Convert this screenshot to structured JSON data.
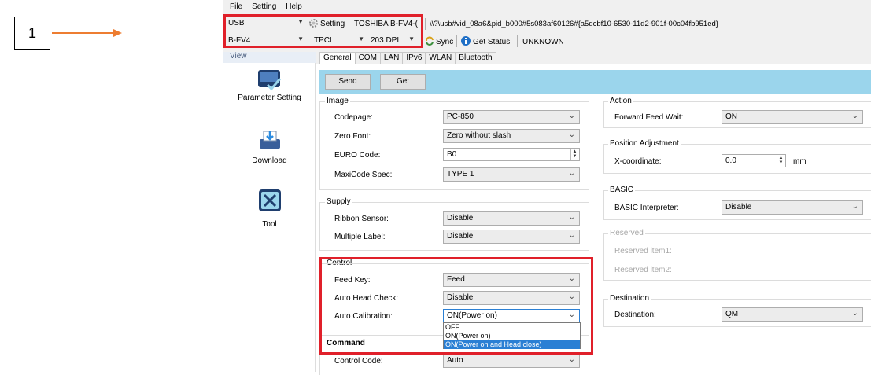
{
  "callout": {
    "number": "1"
  },
  "menubar": [
    "File",
    "Setting",
    "Help"
  ],
  "toolbar": {
    "port": "USB",
    "setting_label": "Setting",
    "printer_name": "TOSHIBA B-FV4-(",
    "device_path": "\\\\?\\usb#vid_08a6&pid_b000#5s083af60126#{a5dcbf10-6530-11d2-901f-00c04fb951ed}",
    "model": "B-FV4",
    "language": "TPCL",
    "dpi": "203 DPI",
    "sync_label": "Sync",
    "get_status_label": "Get Status",
    "status": "UNKNOWN"
  },
  "nav": {
    "header": "View",
    "items": [
      {
        "label": "Parameter Setting",
        "icon": "parameter-setting-icon"
      },
      {
        "label": "Download",
        "icon": "download-printer-icon"
      },
      {
        "label": "Tool",
        "icon": "tool-icon"
      }
    ]
  },
  "tabs": [
    "General",
    "COM",
    "LAN",
    "IPv6",
    "WLAN",
    "Bluetooth"
  ],
  "buttons": {
    "send": "Send",
    "get": "Get"
  },
  "groups": {
    "image": {
      "title": "Image",
      "codepage_label": "Codepage:",
      "codepage_value": "PC-850",
      "zerofont_label": "Zero Font:",
      "zerofont_value": "Zero without slash",
      "euro_label": "EURO Code:",
      "euro_value": "B0",
      "maxicode_label": "MaxiCode Spec:",
      "maxicode_value": "TYPE 1"
    },
    "supply": {
      "title": "Supply",
      "ribbon_label": "Ribbon Sensor:",
      "ribbon_value": "Disable",
      "multilabel_label": "Multiple Label:",
      "multilabel_value": "Disable"
    },
    "control": {
      "title": "Control",
      "feedkey_label": "Feed Key:",
      "feedkey_value": "Feed",
      "autohead_label": "Auto Head Check:",
      "autohead_value": "Disable",
      "autocal_label": "Auto Calibration:",
      "autocal_value": "ON(Power on)",
      "autocal_options": [
        "OFF",
        "ON(Power on)",
        "ON(Power on and Head close)"
      ]
    },
    "command": {
      "title": "Command",
      "controlcode_label": "Control Code:",
      "controlcode_value": "Auto"
    },
    "action": {
      "title": "Action",
      "ffwait_label": "Forward Feed Wait:",
      "ffwait_value": "ON"
    },
    "position": {
      "title": "Position Adjustment",
      "xcoord_label": "X-coordinate:",
      "xcoord_value": "0.0",
      "xcoord_unit": "mm"
    },
    "basic": {
      "title": "BASIC",
      "interpreter_label": "BASIC Interpreter:",
      "interpreter_value": "Disable"
    },
    "reserved": {
      "title": "Reserved",
      "item1": "Reserved item1:",
      "item2": "Reserved item2:"
    },
    "destination": {
      "title": "Destination",
      "dest_label": "Destination:",
      "dest_value": "QM"
    }
  },
  "colors": {
    "highlight_red": "#e0202a",
    "accent_blue": "#9bd5ec",
    "arrow_orange": "#ed7d31",
    "selection_blue": "#2a7fd4"
  }
}
